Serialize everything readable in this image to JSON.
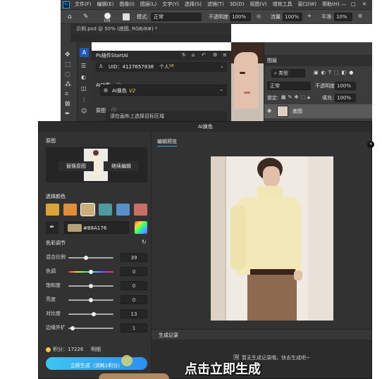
{
  "ps": {
    "menu": [
      "文件(F)",
      "编辑(E)",
      "图像(I)",
      "图层(L)",
      "文字(Y)",
      "选择(S)",
      "滤镜(T)",
      "3D(D)",
      "视图(V)",
      "增效工具",
      "窗口(W)",
      "帮助(H)"
    ],
    "options": {
      "brush_size": "108",
      "mode_label": "模式:",
      "mode_value": "正常",
      "opacity_label": "不透明度:",
      "opacity_value": "100%",
      "flow_label": "流量:",
      "flow_value": "100%",
      "smooth_label": "平滑:",
      "smooth_value": "10%"
    },
    "doc_tab": "示例.psd @ 50% (底图, RGB/8#) *",
    "plugin": {
      "title": "Ps插件StartAI",
      "uid_label": "UID：4127657838",
      "account": "个人",
      "account_badge": "V8",
      "section_ai_func": "AI功能",
      "func_selected": "AI换色",
      "func_version": "V2",
      "section_original": "原图",
      "hint": "请在画布上选择目标区域"
    },
    "layers": {
      "tab": "图层",
      "filter_kind": "类型",
      "blend": "正常",
      "opacity_label": "不透明度:",
      "opacity_value": "100%",
      "lock_label": "锁定:",
      "fill_label": "填充:",
      "fill_value": "100%",
      "layer_name": "底图"
    }
  },
  "dialog": {
    "title": "AI换色",
    "original_label": "原图",
    "replace_btn": "替换原图",
    "continue_btn": "继续编辑",
    "select_color_label": "选择颜色",
    "swatches": [
      "#D9A43A",
      "#E08E3C",
      "#C9AE7C",
      "#4E9AA0",
      "#5A90C8",
      "#C96F6A"
    ],
    "current_color": "#B8A176",
    "hex_value": "#B8A176",
    "adjust_label": "色彩调节",
    "sliders": [
      {
        "label": "混合比例",
        "value": "39",
        "ratio": 0.39
      },
      {
        "label": "色调",
        "value": "0",
        "ratio": 0.5
      },
      {
        "label": "饱和度",
        "value": "0",
        "ratio": 0.5
      },
      {
        "label": "亮度",
        "value": "0",
        "ratio": 0.5
      },
      {
        "label": "对比度",
        "value": "13",
        "ratio": 0.57
      },
      {
        "label": "边缘外扩",
        "value": "1",
        "ratio": 0.1
      }
    ],
    "points_label": "积分：17226",
    "points_detail": "明细",
    "generate_btn": "立即生成（消耗1积分）",
    "preview_tab": "编辑预览",
    "history_tab": "生成记录",
    "history_empty": "暂无生成记录哦，快去生成吧~"
  },
  "subtitle": "点击立即生成"
}
